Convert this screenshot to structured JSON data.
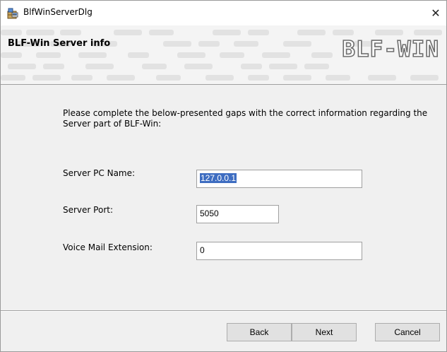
{
  "window": {
    "title": "BlfWinServerDlg",
    "close_glyph": "✕"
  },
  "banner": {
    "title": "BLF-Win Server info",
    "logo_text": "BLF-WIN"
  },
  "description": "Please complete the below-presented gaps with the correct information regarding the Server part of BLF-Win:",
  "fields": {
    "server_pc_name": {
      "label": "Server PC Name:",
      "value": "127.0.0.1"
    },
    "server_port": {
      "label": "Server Port:",
      "value": "5050"
    },
    "voice_mail_extension": {
      "label": "Voice Mail Extension:",
      "value": "0"
    }
  },
  "buttons": {
    "back": "Back",
    "next": "Next",
    "cancel": "Cancel"
  },
  "colors": {
    "selection": "#3e6dc1",
    "banner_bg": "#f4f4f4"
  },
  "icons": {
    "app": "installer-package-icon",
    "close": "close-icon"
  }
}
